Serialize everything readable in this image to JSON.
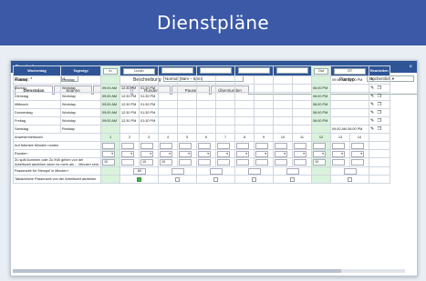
{
  "banner": {
    "title": "Dienstpläne"
  },
  "dialog": {
    "title": "Bearbeiten",
    "close": "×",
    "plan_label": "Planer: *",
    "plan_value": "1",
    "desc_label": "Beschreibung",
    "desc_value": "Normal (9am – 6pm)",
    "type_label": "Plantyp",
    "type_value": "Wöchentlich ▾"
  },
  "tabs": [
    {
      "label": "Dienstplan"
    },
    {
      "label": "Spanne"
    },
    {
      "label": "Gewerbl"
    },
    {
      "label": "Runden"
    },
    {
      "label": "Pause"
    },
    {
      "label": "Überstunden"
    }
  ],
  "table": {
    "headers": {
      "weekday": "Wochentag",
      "daytype": "Tagestyp",
      "in": "In",
      "lunch": "Lunch",
      "out": "Out",
      "ot": "OT",
      "edit": "Bearbeiten"
    },
    "rows": [
      {
        "day": "Sonntag",
        "type": "Restday",
        "in": "",
        "l1": "",
        "l2": "",
        "out": "",
        "ot": "09:00 AM  06:00 PM"
      },
      {
        "day": "Montag",
        "type": "Workday",
        "in": "09:00 AM",
        "l1": "12:30 PM",
        "l2": "01:30 PM",
        "out": "06:00 PM",
        "ot": ""
      },
      {
        "day": "Dienstag",
        "type": "Workday",
        "in": "09:00 AM",
        "l1": "12:30 PM",
        "l2": "01:30 PM",
        "out": "06:00 PM",
        "ot": ""
      },
      {
        "day": "Mittwoch",
        "type": "Workday",
        "in": "09:00 AM",
        "l1": "12:30 PM",
        "l2": "01:30 PM",
        "out": "06:00 PM",
        "ot": ""
      },
      {
        "day": "Donnerstag",
        "type": "Workday",
        "in": "09:00 AM",
        "l1": "12:30 PM",
        "l2": "01:30 PM",
        "out": "06:00 PM",
        "ot": ""
      },
      {
        "day": "Freitag",
        "type": "Workday",
        "in": "09:00 AM",
        "l1": "12:30 PM",
        "l2": "01:30 PM",
        "out": "06:00 PM",
        "ot": ""
      },
      {
        "day": "Samstag",
        "type": "Restday",
        "in": "",
        "l1": "",
        "l2": "",
        "out": "",
        "ot": "09:00 AM  06:00 PM"
      }
    ],
    "lower": {
      "numbers_label": "Anwesenheitszahl",
      "numbers": [
        "1",
        "2",
        "3",
        "4",
        "5",
        "6",
        "7",
        "8",
        "9",
        "10",
        "11",
        "12",
        "13",
        "14"
      ],
      "max_minutes_label": "Auf Nächste Minuten runden",
      "rounding_label": "Runden~",
      "early_late_label": "Zu spät kommen oder Zu früh gehen von der Arbeitszeit abziehen wenn es mehr als ... Minuten sind",
      "early_late_values": [
        "10",
        "",
        "10",
        "10",
        "",
        "",
        "",
        "",
        "",
        "",
        "",
        "10",
        "",
        ""
      ],
      "tolerance_label": "Passenzeit für Stempel in Minuten~",
      "tolerance_value": "60",
      "actual_label": "Tatsächliche Passenzeit von der Arbeitszeit abziehen"
    }
  },
  "colors": {
    "banner": "#3b59a6",
    "header": "#2f5597",
    "green": "#d9f2dc"
  }
}
